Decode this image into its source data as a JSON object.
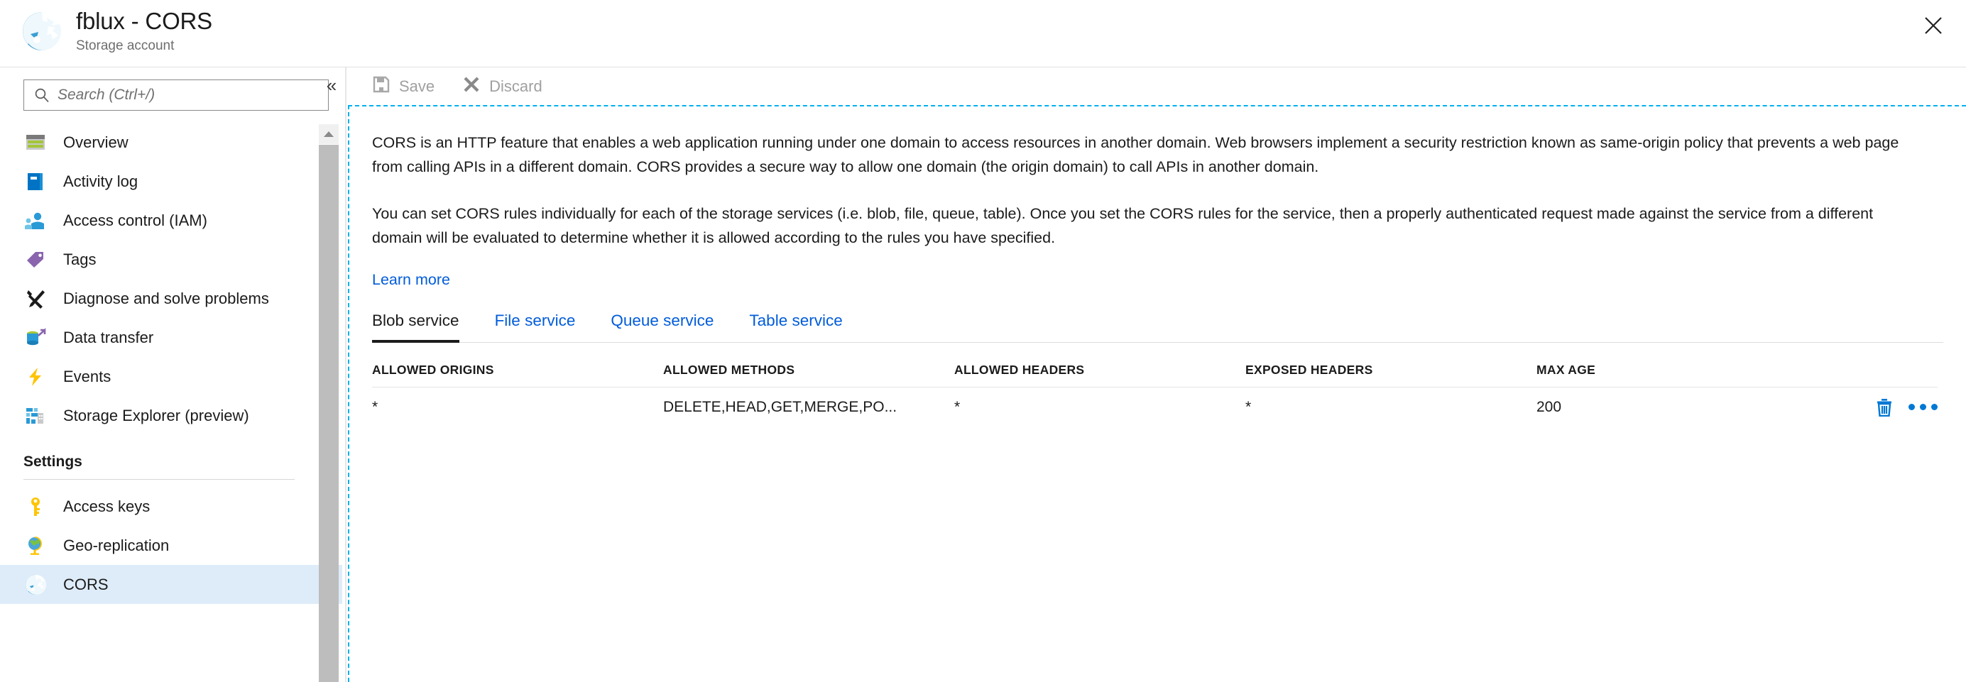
{
  "header": {
    "title": "fblux - CORS",
    "subtitle": "Storage account",
    "icon": "cors-globe-icon",
    "close_label": "close-icon"
  },
  "search": {
    "placeholder": "Search (Ctrl+/)",
    "value": "",
    "icon": "search-icon"
  },
  "sidebar": {
    "collapse_glyph": "«",
    "items": [
      {
        "label": "Overview",
        "icon": "overview-icon",
        "selected": false
      },
      {
        "label": "Activity log",
        "icon": "activity-log-icon",
        "selected": false
      },
      {
        "label": "Access control (IAM)",
        "icon": "access-control-icon",
        "selected": false
      },
      {
        "label": "Tags",
        "icon": "tags-icon",
        "selected": false
      },
      {
        "label": "Diagnose and solve problems",
        "icon": "diagnose-icon",
        "selected": false
      },
      {
        "label": "Data transfer",
        "icon": "data-transfer-icon",
        "selected": false
      },
      {
        "label": "Events",
        "icon": "events-icon",
        "selected": false
      },
      {
        "label": "Storage Explorer (preview)",
        "icon": "storage-explorer-icon",
        "selected": false
      }
    ],
    "settings_section": {
      "title": "Settings",
      "items": [
        {
          "label": "Access keys",
          "icon": "key-icon",
          "selected": false
        },
        {
          "label": "Geo-replication",
          "icon": "globe-icon",
          "selected": false
        },
        {
          "label": "CORS",
          "icon": "cors-globe-icon",
          "selected": true
        }
      ]
    }
  },
  "toolbar": {
    "save_label": "Save",
    "discard_label": "Discard",
    "save_icon": "save-floppy-icon",
    "discard_icon": "discard-x-icon"
  },
  "main": {
    "paragraph_1": "CORS is an HTTP feature that enables a web application running under one domain to access resources in another domain. Web browsers implement a security restriction known as same-origin policy that prevents a web page from calling APIs in a different domain. CORS provides a secure way to allow one domain (the origin domain) to call APIs in another domain.",
    "paragraph_2": "You can set CORS rules individually for each of the storage services (i.e. blob, file, queue, table). Once you set the CORS rules for the service, then a properly authenticated request made against the service from a different domain will be evaluated to determine whether it is allowed according to the rules you have specified.",
    "learn_more": "Learn more",
    "tabs": [
      {
        "label": "Blob service",
        "active": true
      },
      {
        "label": "File service",
        "active": false
      },
      {
        "label": "Queue service",
        "active": false
      },
      {
        "label": "Table service",
        "active": false
      }
    ],
    "table": {
      "columns": [
        "ALLOWED ORIGINS",
        "ALLOWED METHODS",
        "ALLOWED HEADERS",
        "EXPOSED HEADERS",
        "MAX AGE"
      ],
      "rows": [
        {
          "allowed_origins": "*",
          "allowed_methods": "DELETE,HEAD,GET,MERGE,PO...",
          "allowed_headers": "*",
          "exposed_headers": "*",
          "max_age": "200",
          "delete_icon": "trash-icon",
          "more_icon": "ellipsis-icon"
        }
      ]
    }
  },
  "colors": {
    "accent": "#0078d4",
    "link": "#015cda",
    "selected_row": "#deecf9",
    "focus_border": "#00b0f0",
    "disabled_text": "#a0a0a0"
  }
}
